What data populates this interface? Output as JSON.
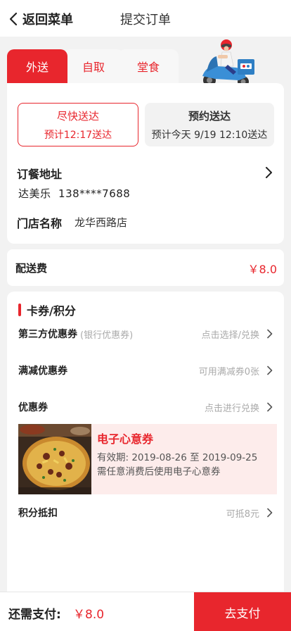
{
  "header": {
    "back_label": "返回菜单",
    "title": "提交订单"
  },
  "tabs": [
    {
      "label": "外送"
    },
    {
      "label": "自取"
    },
    {
      "label": "堂食"
    }
  ],
  "delivery": {
    "fast": {
      "title": "尽快送达",
      "eta": "预计12:17送达"
    },
    "scheduled": {
      "title": "预约送达",
      "eta": "预计今天 9/19 12:10送达"
    }
  },
  "address": {
    "label": "订餐地址",
    "contact": "达美乐  138****7688"
  },
  "store": {
    "label": "门店名称",
    "name": "龙华西路店"
  },
  "fee": {
    "label": "配送费",
    "value": "￥8.0"
  },
  "coupons": {
    "section_title": "卡券/积分",
    "third_party": {
      "label": "第三方优惠券",
      "sub": "(银行优惠券)",
      "hint": "点击选择/兑换"
    },
    "discount": {
      "label": "满减优惠券",
      "hint": "可用满减券0张"
    },
    "coupon": {
      "label": "优惠券",
      "hint": "点击进行兑换"
    },
    "ecard": {
      "title": "电子心意券",
      "validity": "有效期: 2019-08-26 至 2019-09-25",
      "note": "需任意消费后使用电子心意券"
    },
    "points": {
      "label": "积分抵扣",
      "hint": "可抵8元"
    }
  },
  "footer": {
    "pay_label": "还需支付:",
    "pay_value": "￥8.0",
    "pay_button": "去支付"
  },
  "colors": {
    "accent": "#e8262d",
    "background": "#f2f2f2"
  },
  "icons": [
    "back-arrow-icon",
    "chevron-right-icon",
    "scooter-illustration",
    "pizza-image"
  ]
}
